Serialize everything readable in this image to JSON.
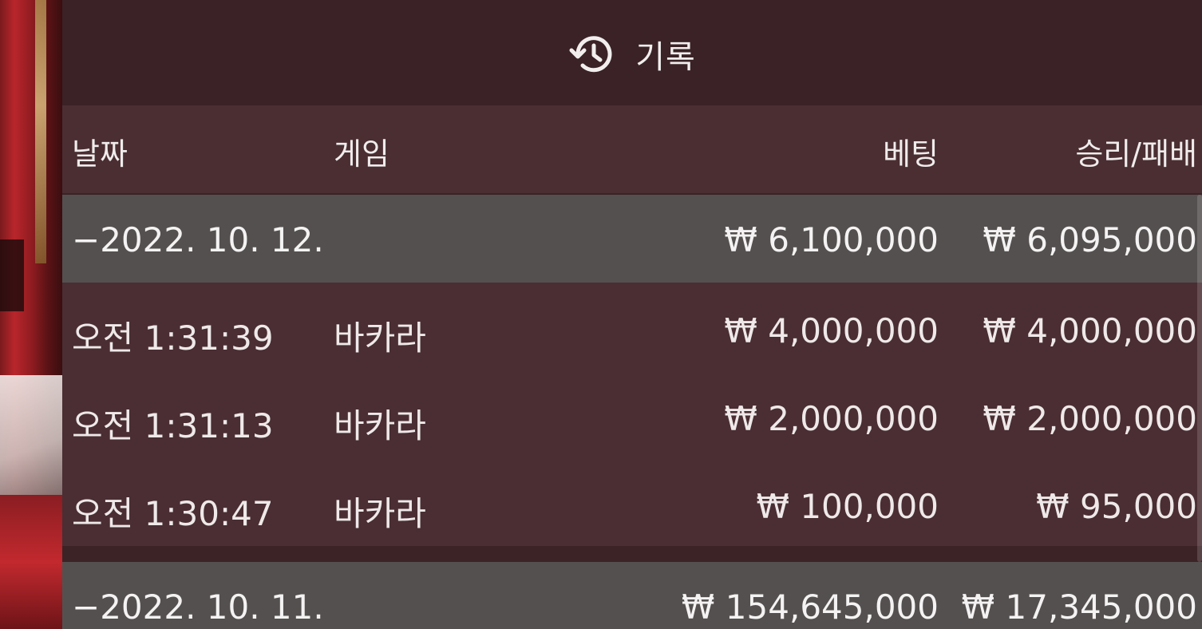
{
  "header": {
    "title": "기록",
    "icon": "history-icon"
  },
  "columns": {
    "date": "날짜",
    "game": "게임",
    "bet": "베팅",
    "result": "승리/패배"
  },
  "groups": [
    {
      "date_label": "−2022. 10. 12.",
      "total_bet": "₩ 6,100,000",
      "total_result": "₩ 6,095,000",
      "rows": [
        {
          "time": "오전 1:31:39",
          "game": "바카라",
          "bet": "₩ 4,000,000",
          "result": "₩ 4,000,000"
        },
        {
          "time": "오전 1:31:13",
          "game": "바카라",
          "bet": "₩ 2,000,000",
          "result": "₩ 2,000,000"
        },
        {
          "time": "오전 1:30:47",
          "game": "바카라",
          "bet": "₩ 100,000",
          "result": "₩ 95,000"
        }
      ]
    },
    {
      "date_label": "−2022. 10. 11.",
      "total_bet": "₩ 154,645,000",
      "total_result": "₩ 17,345,000",
      "rows": []
    }
  ]
}
